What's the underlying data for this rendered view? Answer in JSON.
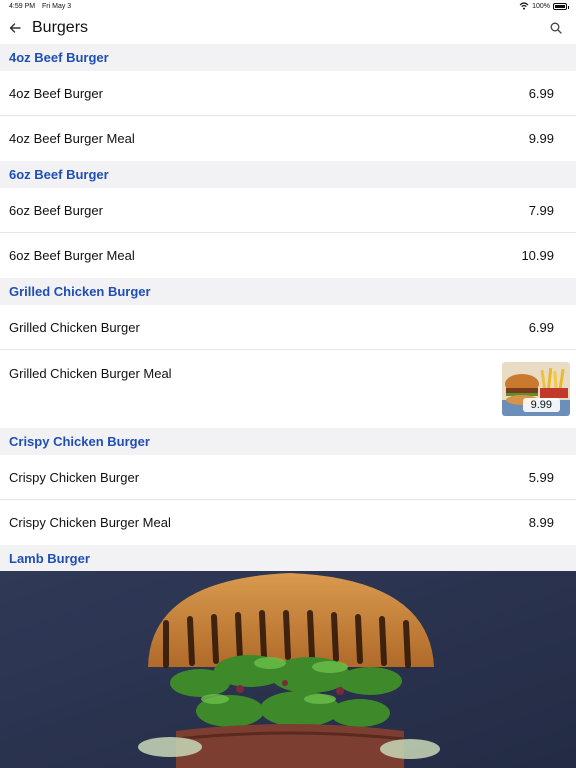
{
  "status": {
    "time": "4:59 PM",
    "date": "Fri May 3",
    "battery": "100%"
  },
  "nav": {
    "title": "Burgers"
  },
  "sections": [
    {
      "title": "4oz Beef Burger",
      "items": [
        {
          "name": "4oz Beef Burger",
          "price": "6.99"
        },
        {
          "name": "4oz Beef Burger Meal",
          "price": "9.99"
        }
      ]
    },
    {
      "title": "6oz Beef Burger",
      "items": [
        {
          "name": "6oz Beef Burger",
          "price": "7.99"
        },
        {
          "name": "6oz Beef Burger Meal",
          "price": "10.99"
        }
      ]
    },
    {
      "title": "Grilled Chicken Burger",
      "items": [
        {
          "name": "Grilled Chicken Burger",
          "price": "6.99"
        },
        {
          "name": "Grilled Chicken Burger Meal",
          "price": "9.99"
        }
      ]
    },
    {
      "title": "Crispy Chicken Burger",
      "items": [
        {
          "name": "Crispy Chicken Burger",
          "price": "5.99"
        },
        {
          "name": "Crispy Chicken Burger Meal",
          "price": "8.99"
        }
      ]
    },
    {
      "title": "Lamb Burger",
      "items": []
    }
  ],
  "colors": {
    "section_title": "#1f4fb4",
    "section_bg": "#f2f2f4",
    "divider": "#e6e6e6"
  },
  "icons": {
    "back": "arrow-left-icon",
    "search": "magnifier-icon",
    "wifi": "wifi-icon",
    "battery": "battery-icon"
  }
}
